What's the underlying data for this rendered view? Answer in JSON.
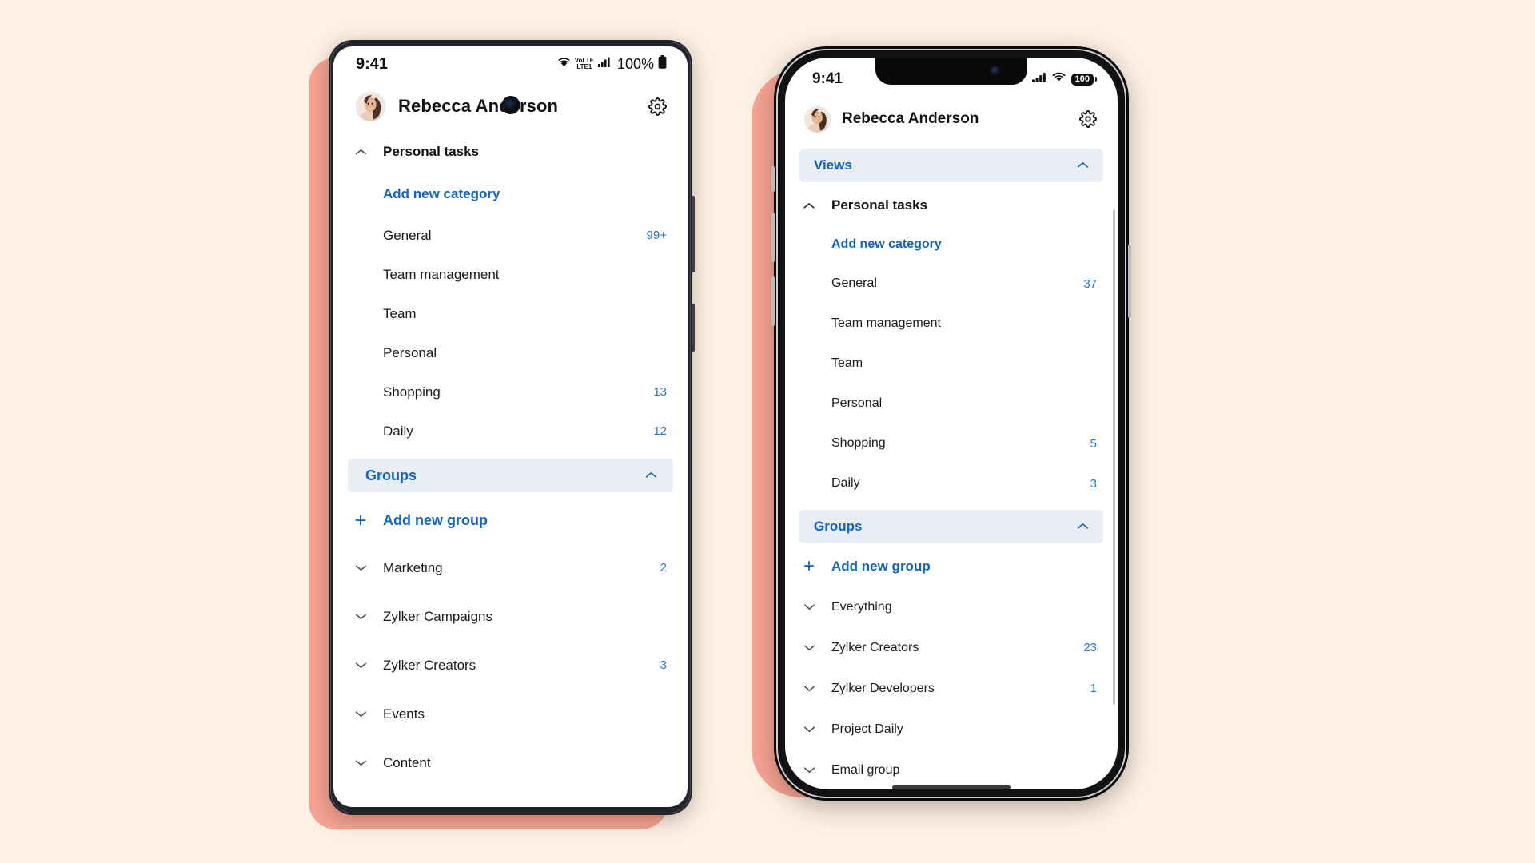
{
  "page": {
    "background_color": "#fdf1e3",
    "accent_color": "#1263c4",
    "shadow_block_color": "#f7a393"
  },
  "android": {
    "device": "android-phone",
    "status_bar": {
      "time": "9:41",
      "network_label_top": "VoLTE",
      "network_label_bottom": "LTE1",
      "battery_percent": "100%",
      "wifi_icon": "wifi-icon",
      "signal_icon": "signal-bars-icon",
      "battery_icon": "battery-full-icon",
      "camera": "punch-hole-camera"
    },
    "header": {
      "avatar": "user-avatar",
      "user_name": "Rebecca Anderson",
      "settings_icon": "gear-icon"
    },
    "views": {
      "title": "Personal tasks",
      "collapse_icon": "chevron-up-icon",
      "add_label": "Add new category",
      "categories": [
        {
          "label": "General",
          "count": "99+"
        },
        {
          "label": "Team management",
          "count": ""
        },
        {
          "label": "Team",
          "count": ""
        },
        {
          "label": "Personal",
          "count": ""
        },
        {
          "label": "Shopping",
          "count": "13"
        },
        {
          "label": "Daily",
          "count": "12"
        }
      ]
    },
    "groups": {
      "header_label": "Groups",
      "collapse_icon": "chevron-up-icon",
      "add_label": "Add new group",
      "add_icon": "plus-icon",
      "items": [
        {
          "label": "Marketing",
          "count": "2"
        },
        {
          "label": "Zylker Campaigns",
          "count": ""
        },
        {
          "label": "Zylker Creators",
          "count": "3"
        },
        {
          "label": "Events",
          "count": ""
        },
        {
          "label": "Content",
          "count": ""
        }
      ]
    }
  },
  "iphone": {
    "device": "ios-phone",
    "status_bar": {
      "time": "9:41",
      "battery_percent": "100",
      "signal_icon": "signal-bars-icon",
      "wifi_icon": "wifi-icon",
      "battery_icon": "battery-badge-icon"
    },
    "header": {
      "avatar": "user-avatar",
      "user_name": "Rebecca Anderson",
      "settings_icon": "gear-icon"
    },
    "views": {
      "header_label": "Views",
      "collapse_icon": "chevron-up-icon",
      "title": "Personal tasks",
      "title_collapse_icon": "chevron-up-icon",
      "add_label": "Add new category",
      "categories": [
        {
          "label": "General",
          "count": "37"
        },
        {
          "label": "Team management",
          "count": ""
        },
        {
          "label": "Team",
          "count": ""
        },
        {
          "label": "Personal",
          "count": ""
        },
        {
          "label": "Shopping",
          "count": "5"
        },
        {
          "label": "Daily",
          "count": "3"
        }
      ]
    },
    "groups": {
      "header_label": "Groups",
      "collapse_icon": "chevron-up-icon",
      "add_label": "Add new group",
      "add_icon": "plus-icon",
      "items": [
        {
          "label": "Everything",
          "count": ""
        },
        {
          "label": "Zylker Creators",
          "count": "23"
        },
        {
          "label": "Zylker Developers",
          "count": "1"
        },
        {
          "label": "Project Daily",
          "count": ""
        },
        {
          "label": "Email group",
          "count": ""
        }
      ]
    }
  }
}
